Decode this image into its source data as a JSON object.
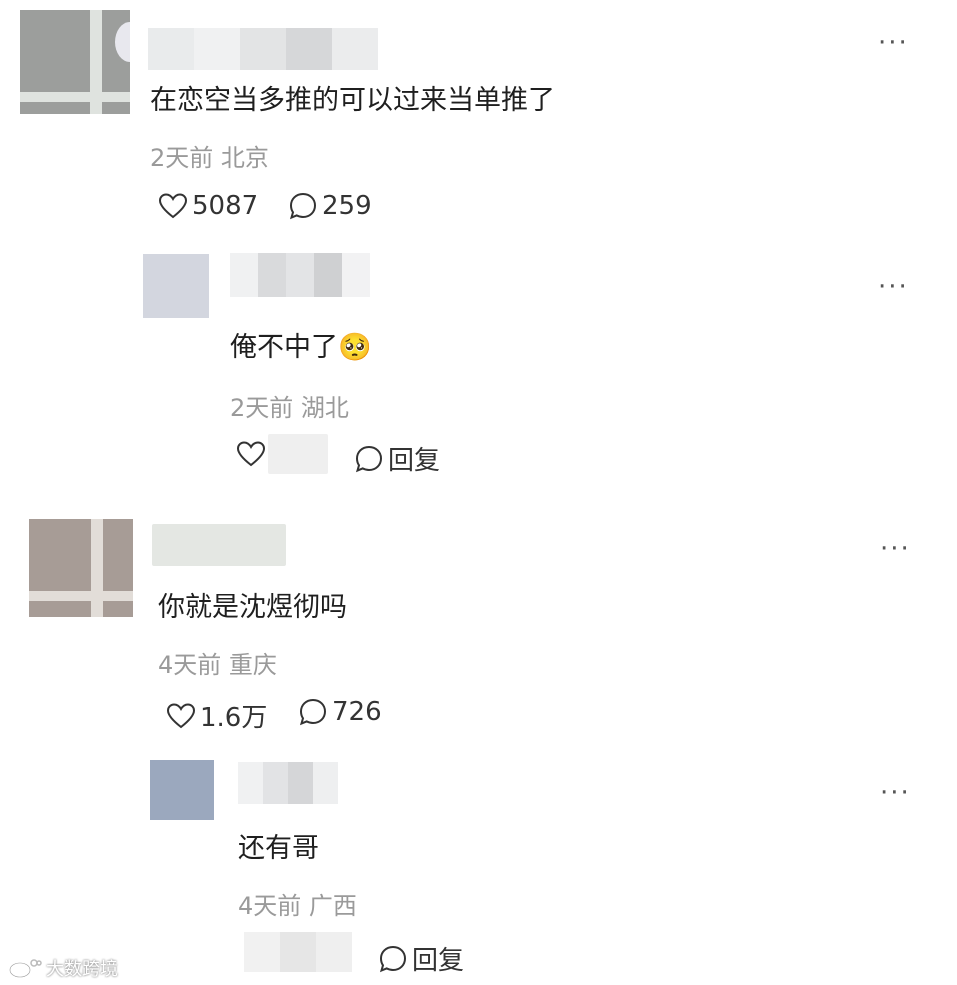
{
  "comments": [
    {
      "text": "在恋空当多推的可以过来当单推了",
      "meta": "2天前 北京",
      "likes": "5087",
      "replies": "259",
      "more": "···"
    },
    {
      "text": "俺不中了",
      "emoji": "🥺",
      "meta": "2天前 湖北",
      "reply_label": "回复",
      "more": "···"
    },
    {
      "text": "你就是沈煜彻吗",
      "meta": "4天前 重庆",
      "likes": "1.6万",
      "replies": "726",
      "more": "···"
    },
    {
      "text": "还有哥",
      "meta": "4天前 广西",
      "reply_label": "回复",
      "more": "···"
    }
  ],
  "watermark": "大数跨境",
  "icons": {
    "like": "heart-outline-icon",
    "reply": "speech-bubble-icon",
    "more": "more-dots-icon"
  }
}
